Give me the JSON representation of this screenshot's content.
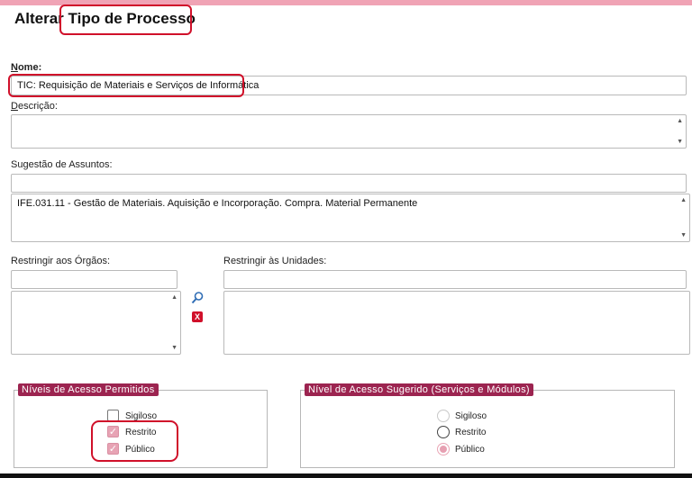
{
  "title": {
    "prefix": "Alterar",
    "highlighted": "Tipo de Processo"
  },
  "form": {
    "nome": {
      "label": "Nome:",
      "label_access_key": "N",
      "label_rest": "ome:",
      "value": "TIC: Requisição de Materiais e Serviços de Informática"
    },
    "descricao": {
      "label_access_key": "D",
      "label_rest": "escrição:",
      "value": ""
    },
    "sugestao_assuntos": {
      "label": "Sugestão de Assuntos:",
      "input_value": "",
      "list": [
        "IFE.031.11 - Gestão de Materiais. Aquisição e Incorporação. Compra. Material Permanente"
      ]
    },
    "restringir_orgaos": {
      "label": "Restringir aos Órgãos:",
      "input_value": ""
    },
    "restringir_unidades": {
      "label": "Restringir às Unidades:",
      "input_value": ""
    },
    "icons": {
      "search": "magnifier-icon",
      "remove": "remove-x-icon",
      "remove_glyph": "X"
    }
  },
  "niveis_acesso": {
    "legend": "Níveis de Acesso Permitidos",
    "options": [
      {
        "label": "Sigiloso",
        "checked": false
      },
      {
        "label": "Restrito",
        "checked": true
      },
      {
        "label": "Público",
        "checked": true
      }
    ]
  },
  "nivel_sugerido": {
    "legend": "Nível de Acesso Sugerido (Serviços e Módulos)",
    "options": [
      {
        "label": "Sigiloso",
        "selected": false
      },
      {
        "label": "Restrito",
        "selected": false
      },
      {
        "label": "Público",
        "selected": true
      }
    ]
  },
  "colors": {
    "accent_bar": "#f0a3b5",
    "legend_bg": "#9c2450",
    "highlight_border": "#d0102a",
    "checked_fill": "#e7a3b4"
  }
}
